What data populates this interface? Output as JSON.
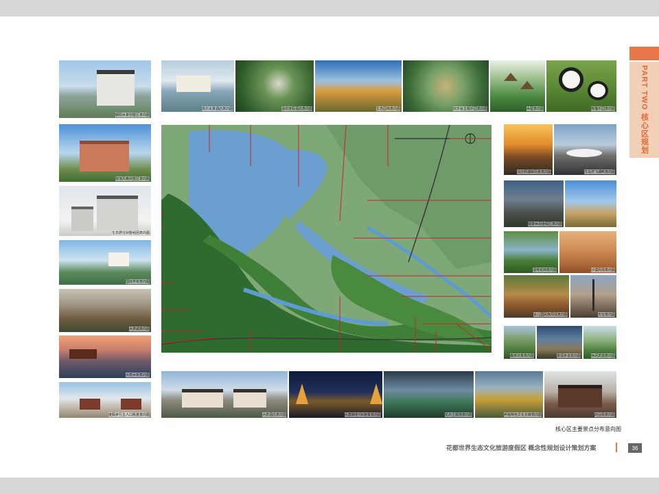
{
  "header": {
    "tab_text": "PART TWO 核心区规划"
  },
  "left_thumbs": [
    {
      "caption": "朝阳水景别墅区意向图"
    },
    {
      "caption": "院落风格别墅区意向图"
    },
    {
      "caption": "生态居住别墅组团意向图"
    },
    {
      "caption": "国际学校意向图"
    },
    {
      "caption": "大唐城意向图"
    },
    {
      "caption": "大唐水街意向图"
    },
    {
      "caption": "度假步行主人口街景意向图"
    }
  ],
  "top_thumbs": [
    {
      "caption": "高尔夫景酒店意向图"
    },
    {
      "caption": "温泉度假酒店意向图"
    },
    {
      "caption": "生态园林意向图"
    },
    {
      "caption": "欢乐谷主题乐园意向图"
    },
    {
      "caption": "木屋意向图"
    },
    {
      "caption": "熊猫乐园意向图"
    }
  ],
  "right_thumbs": [
    {
      "caption": "乌托邦湖岸风景意向图"
    },
    {
      "caption": "万马齐飞湖畔意向图"
    },
    {
      "caption": "健康休闲度假区意向图"
    },
    {
      "caption": "湿地花田意向图"
    },
    {
      "caption": "沙漠风情意向图"
    },
    {
      "caption": "女儿国民族风情意向图"
    },
    {
      "caption": "天坛意向图"
    },
    {
      "caption": "森林日景意向图"
    },
    {
      "caption": "景观步道意向图"
    },
    {
      "caption": "休闲宾馆意向图"
    }
  ],
  "bottom_thumbs": [
    {
      "caption": "大唐酒店意向图"
    },
    {
      "caption": "大唐御寺706夜景意向图"
    },
    {
      "caption": "花卉主题馆意向图"
    },
    {
      "caption": "养殖特色文化长廊意向图"
    },
    {
      "caption": "商业街意向图"
    }
  ],
  "map_caption": "核心区主要景点分布意向图",
  "footer": {
    "title": "花都世界生态文化旅游度假区 概念性规划设计策划方案",
    "page_number": "36"
  },
  "colors": {
    "accent": "#e8784a",
    "tab_bg": "#f2d0b8",
    "line_red": "#c8232c",
    "water": "#6f9fc8",
    "forest": "#3f7a3b"
  }
}
